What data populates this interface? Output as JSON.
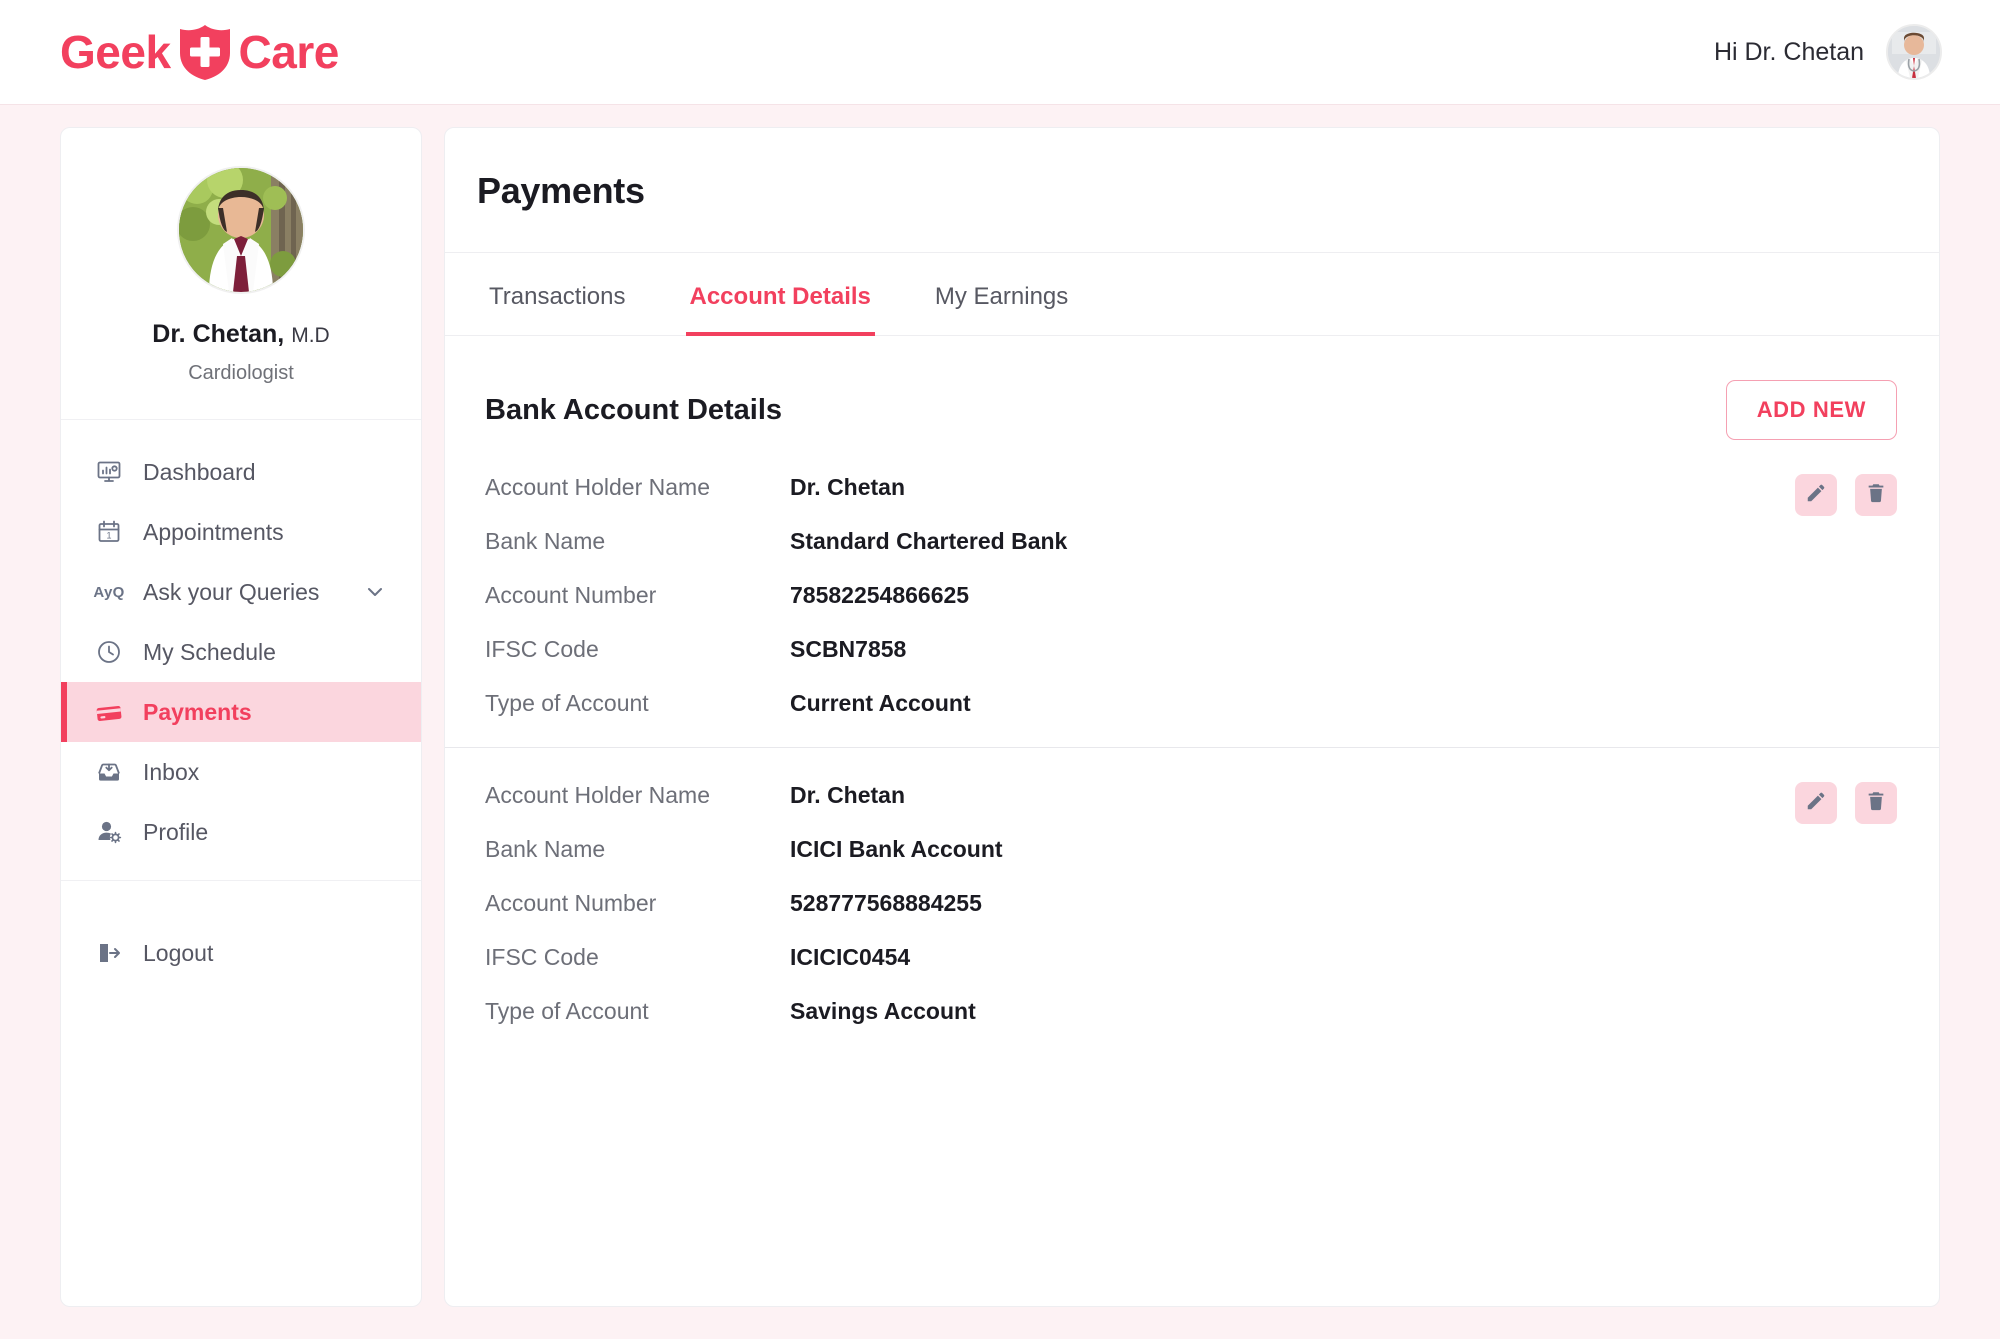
{
  "brand": {
    "name_left": "Geek",
    "name_right": "Care",
    "shield_icon": "shield-plus-icon",
    "color": "#f2405e"
  },
  "header": {
    "greeting": "Hi Dr. Chetan",
    "avatar_icon": "user-avatar-doctor-male"
  },
  "sidebar": {
    "profile": {
      "avatar_icon": "user-avatar-doctor-female",
      "name": "Dr. Chetan,",
      "degree": "M.D",
      "specialty": "Cardiologist"
    },
    "items": [
      {
        "label": "Dashboard",
        "icon": "monitor-chart-icon",
        "active": false,
        "chevron": false
      },
      {
        "label": "Appointments",
        "icon": "calendar-icon",
        "active": false,
        "chevron": false
      },
      {
        "label": "Ask your Queries",
        "icon": "ayq-text-icon",
        "active": false,
        "chevron": true
      },
      {
        "label": "My Schedule",
        "icon": "clock-icon",
        "active": false,
        "chevron": false
      },
      {
        "label": "Payments",
        "icon": "credit-card-icon",
        "active": true,
        "chevron": false
      },
      {
        "label": "Inbox",
        "icon": "inbox-icon",
        "active": false,
        "chevron": false
      },
      {
        "label": "Profile",
        "icon": "user-gear-icon",
        "active": false,
        "chevron": false
      }
    ],
    "footer": {
      "label": "Logout",
      "icon": "logout-door-icon"
    }
  },
  "main": {
    "page_title": "Payments",
    "tabs": [
      {
        "label": "Transactions",
        "active": false
      },
      {
        "label": "Account Details",
        "active": true
      },
      {
        "label": "My Earnings",
        "active": false
      }
    ],
    "section_title": "Bank Account Details",
    "add_new_label": "ADD NEW",
    "field_labels": {
      "holder": "Account Holder Name",
      "bank": "Bank Name",
      "number": "Account Number",
      "ifsc": "IFSC Code",
      "type": "Type of Account"
    },
    "row_actions": {
      "edit_icon": "pencil-edit-icon",
      "delete_icon": "trash-delete-icon"
    },
    "accounts": [
      {
        "holder": "Dr. Chetan",
        "bank": "Standard Chartered Bank",
        "number": "78582254866625",
        "ifsc": "SCBN7858",
        "type": "Current Account"
      },
      {
        "holder": "Dr. Chetan",
        "bank": "ICICI Bank Account",
        "number": "528777568884255",
        "ifsc": "ICICIC0454",
        "type": "Savings Account"
      }
    ]
  },
  "colors": {
    "accent": "#f2405e",
    "accent_soft": "#fbd6de",
    "page_bg": "#fdf2f4",
    "text_muted": "#6d6f78"
  }
}
